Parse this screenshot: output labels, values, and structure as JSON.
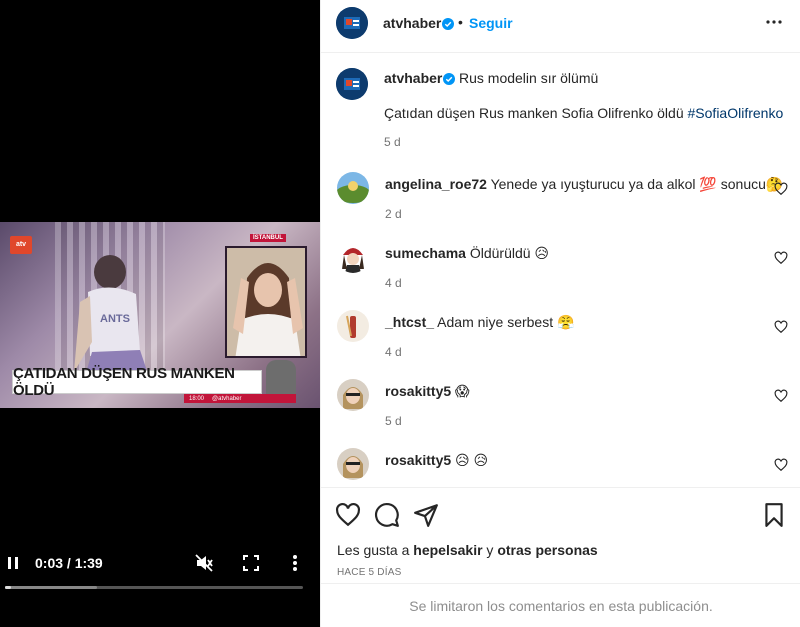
{
  "video": {
    "headline": "ÇATIDAN DÜŞEN RUS MANKEN ÖLDÜ",
    "tv_label": "İSTANBUL",
    "logo_text": "atv",
    "ticker_time": "18:00",
    "ticker_handle": "@atvhaber",
    "time_display": "0:03 / 1:39",
    "progress_fraction": 0.02,
    "buffered_fraction": 0.31
  },
  "header": {
    "username": "atvhaber",
    "separator": "•",
    "follow_label": "Seguir"
  },
  "caption": {
    "username": "atvhaber",
    "title": "Rus modelin sır ölümü",
    "body": "Çatıdan düşen Rus manken Sofia Olifrenko öldü ",
    "hashtag": "#SofiaOlifrenko",
    "time": "5 d"
  },
  "comments": [
    {
      "username": "angelina_roe72",
      "text": "Yenede ya ıyuşturucu ya da alkol 💯 sonucu🤔",
      "time": "2 d"
    },
    {
      "username": "sumechama",
      "text": "Öldürüldü 😥",
      "time": "4 d"
    },
    {
      "username": "_htcst_",
      "text": "Adam niye serbest 😤",
      "time": "4 d"
    },
    {
      "username": "rosakitty5",
      "text": "😱",
      "time": "5 d"
    },
    {
      "username": "rosakitty5",
      "text": "😥 😥",
      "time": ""
    }
  ],
  "likes": {
    "prefix": "Les gusta a ",
    "user": "hepelsakir",
    "middle": " y ",
    "others": "otras personas"
  },
  "posted": "HACE 5 DÍAS",
  "limited_notice": "Se limitaron los comentarios en esta publicación.",
  "colors": {
    "accent_blue": "#0095f6",
    "hashtag": "#00376b",
    "muted": "#737373",
    "brand_red": "#c2153a"
  }
}
